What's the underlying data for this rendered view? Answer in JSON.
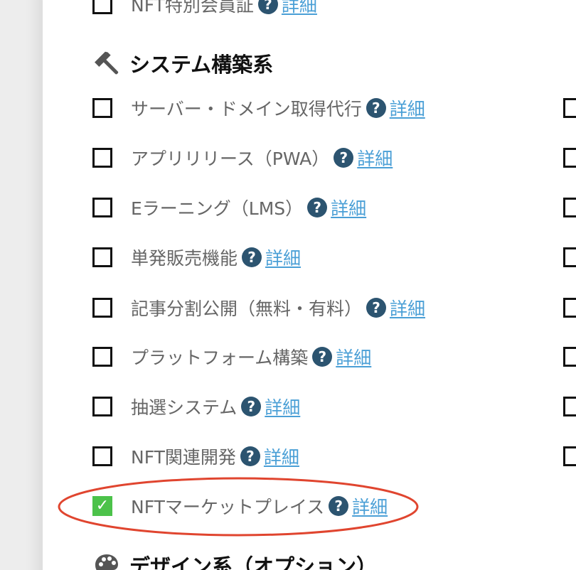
{
  "top_partial_item": {
    "label": "NFT特別会員証",
    "help_icon": "question-circle-icon",
    "detail_link": "詳細",
    "checked": false
  },
  "section_system": {
    "icon": "hammer-icon",
    "title": "システム構築系"
  },
  "items": [
    {
      "label": "サーバー・ドメイン取得代行",
      "help_icon": "question-circle-icon",
      "detail_link": "詳細",
      "checked": false
    },
    {
      "label": "アプリリリース（PWA）",
      "help_icon": "question-circle-icon",
      "detail_link": "詳細",
      "checked": false
    },
    {
      "label": "Eラーニング（LMS）",
      "help_icon": "question-circle-icon",
      "detail_link": "詳細",
      "checked": false
    },
    {
      "label": "単発販売機能",
      "help_icon": "question-circle-icon",
      "detail_link": "詳細",
      "checked": false
    },
    {
      "label": "記事分割公開（無料・有料）",
      "help_icon": "question-circle-icon",
      "detail_link": "詳細",
      "checked": false
    },
    {
      "label": "プラットフォーム構築",
      "help_icon": "question-circle-icon",
      "detail_link": "詳細",
      "checked": false
    },
    {
      "label": "抽選システム",
      "help_icon": "question-circle-icon",
      "detail_link": "詳細",
      "checked": false
    },
    {
      "label": "NFT関連開発",
      "help_icon": "question-circle-icon",
      "detail_link": "詳細",
      "checked": false
    },
    {
      "label": "NFTマーケットプレイス",
      "help_icon": "question-circle-icon",
      "detail_link": "詳細",
      "checked": true
    }
  ],
  "section_design": {
    "icon": "palette-icon",
    "title": "デザイン系（オプション）"
  },
  "help_glyph": "?",
  "check_glyph": "✓",
  "colors": {
    "accent_check": "#4cc24a",
    "link": "#4a9fd6",
    "help_icon_bg": "#2c5470",
    "highlight_ellipse": "#e0452f"
  }
}
